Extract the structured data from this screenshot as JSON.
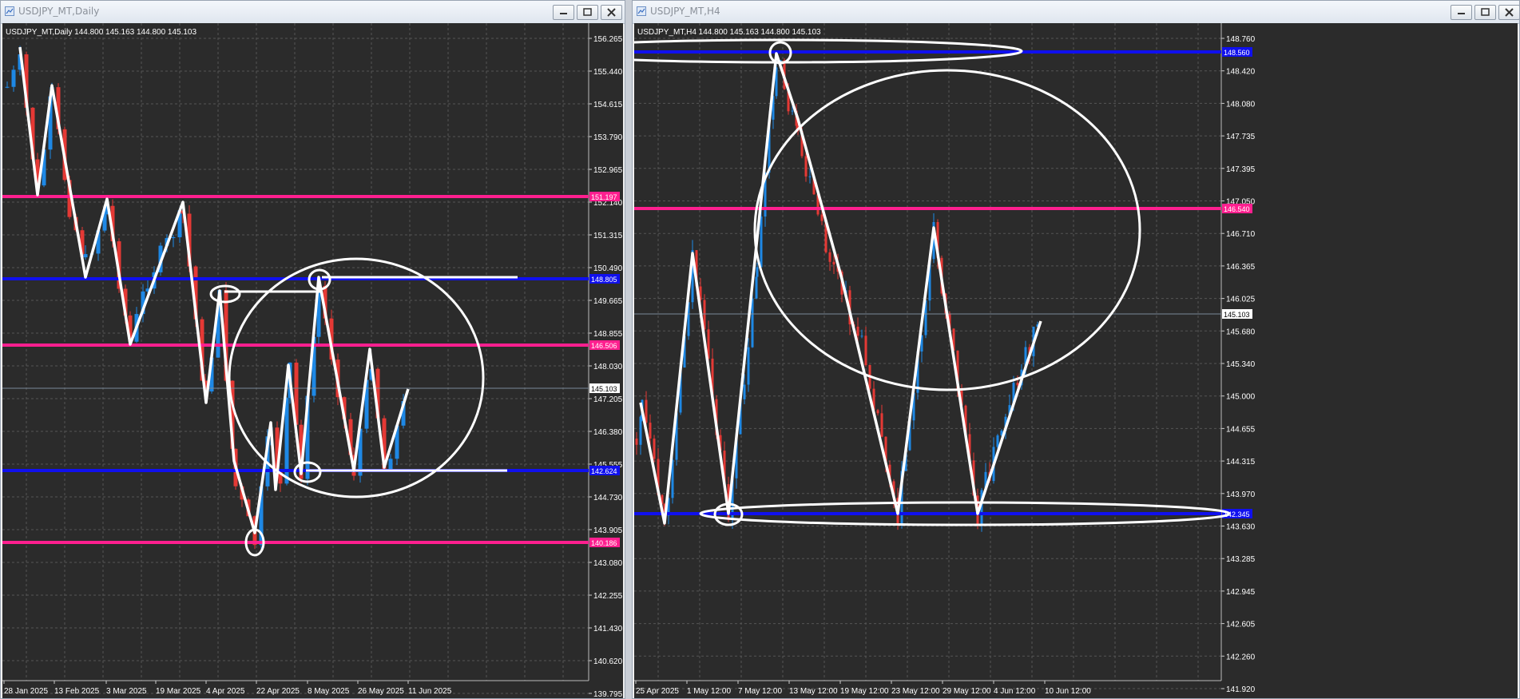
{
  "left": {
    "window_title": "USDJPY_MT,Daily",
    "info": "USDJPY_MT,Daily  144.800 145.163 144.800 145.103",
    "price_labels": [
      "156.265",
      "155.440",
      "154.615",
      "153.790",
      "152.965",
      "152.140",
      "151.315",
      "150.490",
      "149.665",
      "148.855",
      "148.030",
      "147.205",
      "146.380",
      "145.555",
      "144.730",
      "143.905",
      "143.080",
      "142.255",
      "141.430",
      "140.620",
      "139.795"
    ],
    "date_labels": [
      "28 Jan 2025",
      "13 Feb 2025",
      "3 Mar 2025",
      "19 Mar 2025",
      "4 Apr 2025",
      "22 Apr 2025",
      "8 May 2025",
      "26 May 2025",
      "11 Jun 2025"
    ],
    "line_tags": [
      "151.197",
      "148.805",
      "146.506",
      "142.624",
      "140.186"
    ],
    "current_price": "145.103"
  },
  "right": {
    "window_title": "USDJPY_MT,H4",
    "info": "USDJPY_MT,H4  144.800 145.163 144.800 145.103",
    "price_labels": [
      "148.760",
      "148.420",
      "148.080",
      "147.735",
      "147.395",
      "147.050",
      "146.710",
      "146.365",
      "146.025",
      "145.680",
      "145.340",
      "145.000",
      "144.655",
      "144.315",
      "143.970",
      "143.630",
      "143.285",
      "142.945",
      "142.605",
      "142.260",
      "141.920"
    ],
    "date_labels": [
      "25 Apr 2025",
      "1 May 12:00",
      "7 May 12:00",
      "13 May 12:00",
      "19 May 12:00",
      "23 May 12:00",
      "29 May 12:00",
      "4 Jun 12:00",
      "10 Jun 12:00"
    ],
    "line_tags": [
      "148.560",
      "146.540",
      "142.345"
    ],
    "current_price": "145.103"
  },
  "colors": {
    "background": "#2b2b2b",
    "grid": "#555555",
    "axis_text": "#ffffff",
    "bull": "#1e88e5",
    "bear": "#e53935",
    "support_line": "#1010ee",
    "resistance_line": "#ff1f8f",
    "annotation": "#ffffff"
  },
  "icons": [
    "chart-window-icon",
    "minimize-icon",
    "maximize-icon",
    "close-icon"
  ]
}
